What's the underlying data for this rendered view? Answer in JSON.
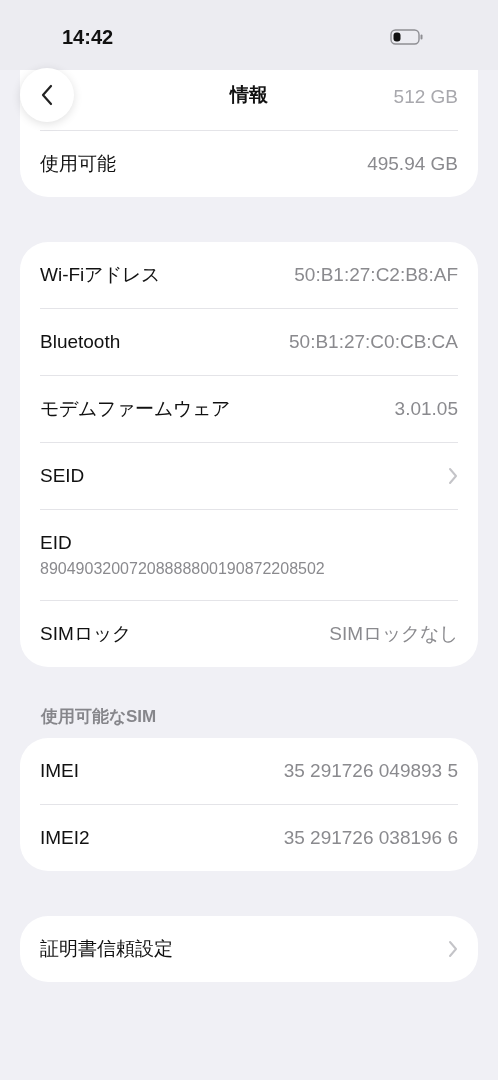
{
  "status_bar": {
    "time": "14:42"
  },
  "nav": {
    "title": "情報"
  },
  "groups": [
    {
      "rows": [
        {
          "kind": "obscured",
          "value": "512 GB"
        },
        {
          "kind": "value",
          "label": "使用可能",
          "value": "495.94 GB"
        }
      ]
    },
    {
      "rows": [
        {
          "kind": "value",
          "label": "Wi-Fiアドレス",
          "value": "50:B1:27:C2:B8:AF"
        },
        {
          "kind": "value",
          "label": "Bluetooth",
          "value": "50:B1:27:C0:CB:CA"
        },
        {
          "kind": "value",
          "label": "モデムファームウェア",
          "value": "3.01.05"
        },
        {
          "kind": "chevron",
          "label": "SEID"
        },
        {
          "kind": "stacked",
          "label": "EID",
          "value": "89049032007208888800190872208502"
        },
        {
          "kind": "value",
          "label": "SIMロック",
          "value": "SIMロックなし"
        }
      ]
    },
    {
      "header": "使用可能なSIM",
      "rows": [
        {
          "kind": "value",
          "label": "IMEI",
          "value": "35 291726 049893 5"
        },
        {
          "kind": "value",
          "label": "IMEI2",
          "value": "35 291726 038196 6"
        }
      ]
    },
    {
      "rows": [
        {
          "kind": "chevron",
          "label": "証明書信頼設定"
        }
      ]
    }
  ]
}
